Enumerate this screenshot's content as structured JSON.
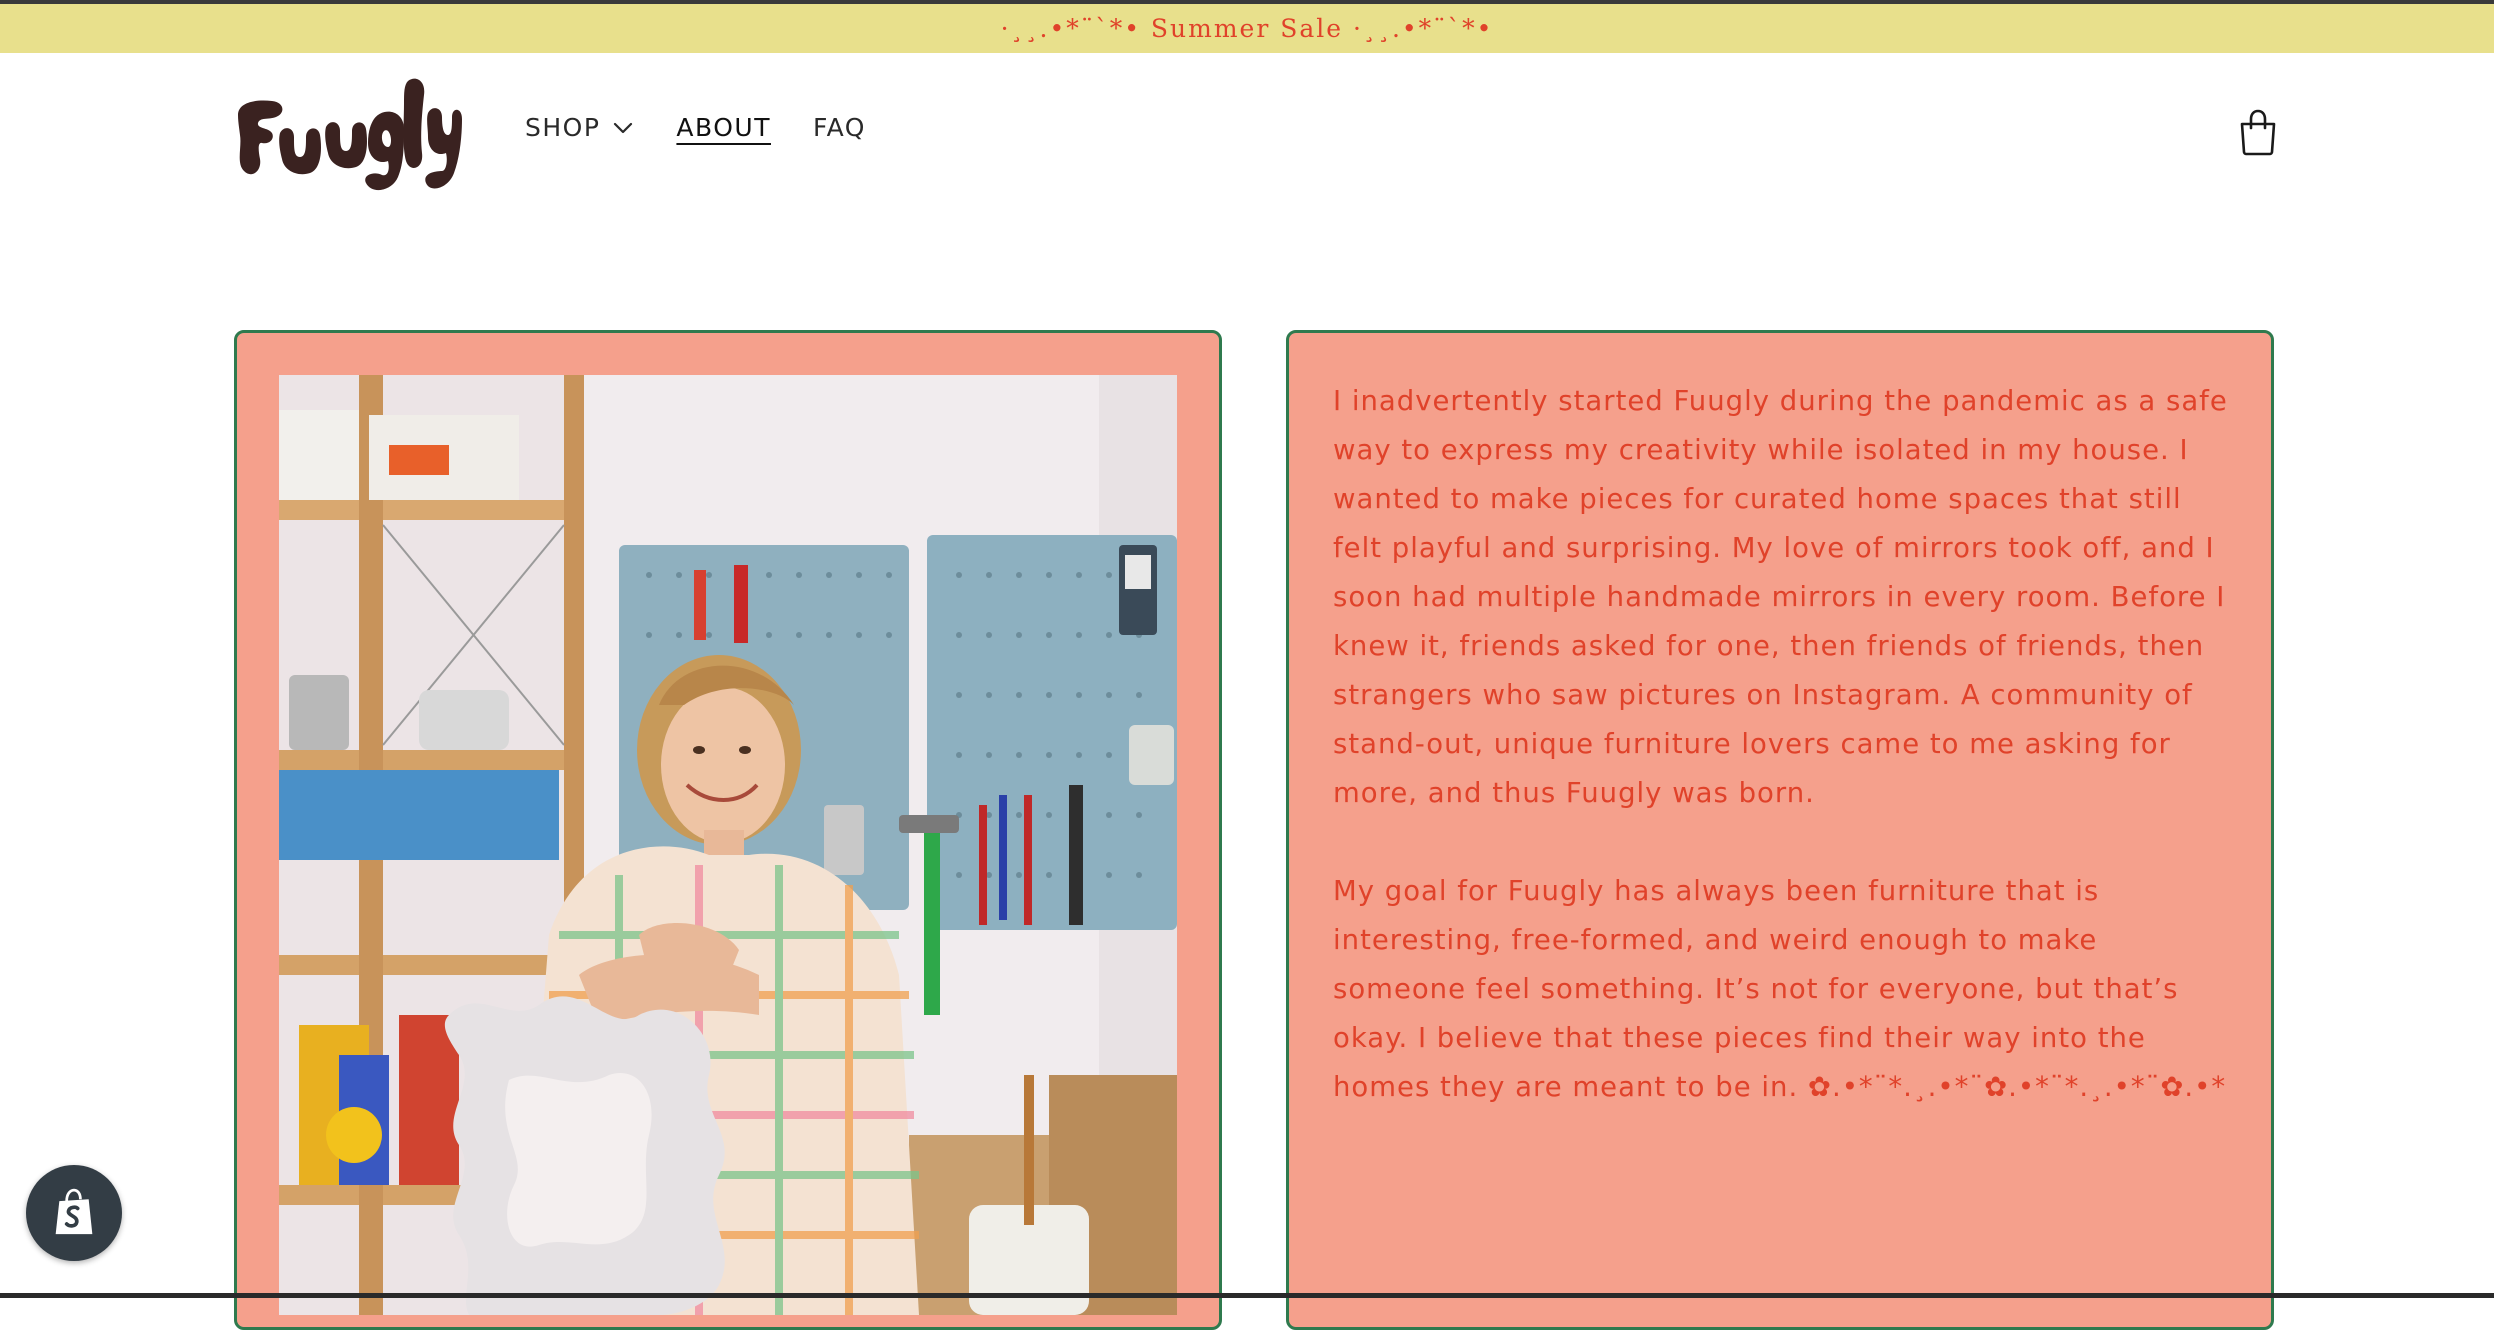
{
  "announcement": {
    "text": "·¸¸.•*¨`*• Summer Sale ·¸¸.•*¨`*•"
  },
  "brand": {
    "logo_text": "Fuugly",
    "logo_color": "#3a2220"
  },
  "nav": {
    "items": [
      {
        "label": "SHOP",
        "has_dropdown": true
      },
      {
        "label": "ABOUT",
        "active": true
      },
      {
        "label": "FAQ"
      }
    ]
  },
  "header": {
    "cart_icon": "shopping-bag-icon"
  },
  "about": {
    "image_subject": "photo-of-founder-in-workshop",
    "paragraphs": [
      "I inadvertently started Fuugly during the pandemic as a safe way to express my creativity while isolated in my house. I wanted to make pieces for curated home spaces that still felt playful and surprising. My love of mirrors took off, and I soon had multiple handmade mirrors in every room. Before I knew it, friends asked for one, then friends of friends, then strangers who saw pictures on Instagram. A community of stand-out, unique furniture lovers came to me asking for more, and thus Fuugly was born.",
      "My goal for Fuugly has always been furniture that is interesting, free-formed, and weird enough to make someone feel something. It’s not for everyone, but that’s okay. I believe that these pieces find their way into the homes they are meant to be in. ✿.•*¨*.¸.•*¨✿.•*¨*.¸.•*¨✿.•*"
    ]
  },
  "shopify_badge": {
    "icon": "shopify-bag-icon"
  },
  "colors": {
    "announcement_bg": "#e8e08c",
    "accent_red": "#e0422a",
    "card_bg": "#f5a08c",
    "card_border": "#2f7a4e"
  }
}
